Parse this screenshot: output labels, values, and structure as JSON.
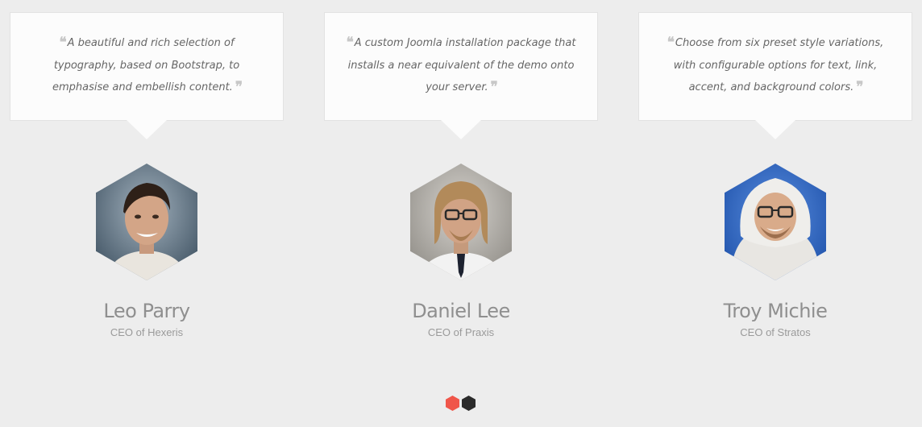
{
  "testimonials": [
    {
      "quote": "A beautiful and rich selection of typography, based on Bootstrap, to emphasise and embellish content.",
      "name": "Leo Parry",
      "role": "CEO of Hexeris"
    },
    {
      "quote": "A custom Joomla installation package that installs a near equivalent of the demo onto your server.",
      "name": "Daniel Lee",
      "role": "CEO of Praxis"
    },
    {
      "quote": "Choose from six preset style variations, with configurable options for text, link, accent, and background colors.",
      "name": "Troy Michie",
      "role": "CEO of Stratos"
    }
  ],
  "quote_marks": {
    "open": "❝",
    "close": "❞"
  },
  "pager": {
    "active_index": 0,
    "count": 2
  },
  "colors": {
    "background": "#ededed",
    "card": "#fcfcfc",
    "accent": "#f0564a",
    "pager_inactive": "#2b2b2b"
  },
  "icons": [
    "open-quote-icon",
    "close-quote-icon"
  ]
}
